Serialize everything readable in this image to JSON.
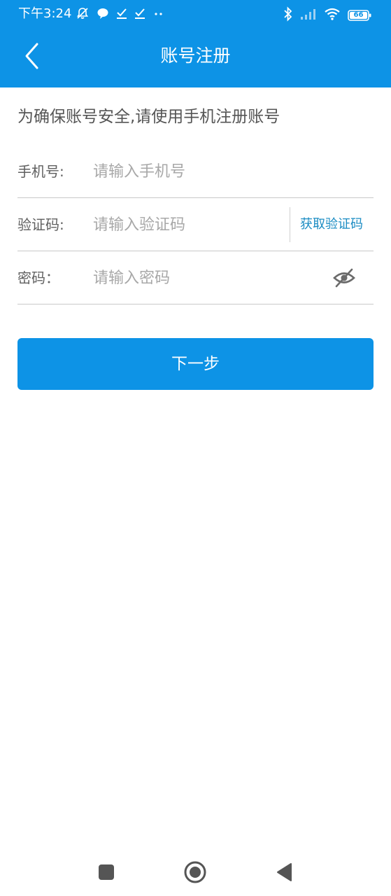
{
  "status_bar": {
    "time": "下午3:24",
    "battery": "66",
    "icons": [
      "mute-bell-icon",
      "chat-bubble-icon",
      "check-icon",
      "check-icon",
      "more-dots-icon",
      "bluetooth-icon",
      "signal-icon",
      "wifi-icon",
      "battery-icon"
    ]
  },
  "header": {
    "title": "账号注册",
    "back_icon": "chevron-left-icon"
  },
  "notice": "为确保账号安全,请使用手机注册账号",
  "form": {
    "phone": {
      "label": "手机号:",
      "placeholder": "请输入手机号",
      "value": ""
    },
    "code": {
      "label": "验证码:",
      "placeholder": "请输入验证码",
      "value": "",
      "get_code_label": "获取验证码"
    },
    "password": {
      "label": "密码：",
      "placeholder": "请输入密码",
      "value": "",
      "toggle_icon": "eye-off-icon"
    }
  },
  "next_button": "下一步",
  "nav_bar": {
    "icons": [
      "recents-square-icon",
      "home-circle-icon",
      "back-triangle-icon"
    ]
  },
  "colors": {
    "primary": "#0d93e6",
    "link": "#1b8cc3",
    "label": "#606060",
    "placeholder": "#a8a8a8",
    "divider": "#c9c9c9"
  }
}
